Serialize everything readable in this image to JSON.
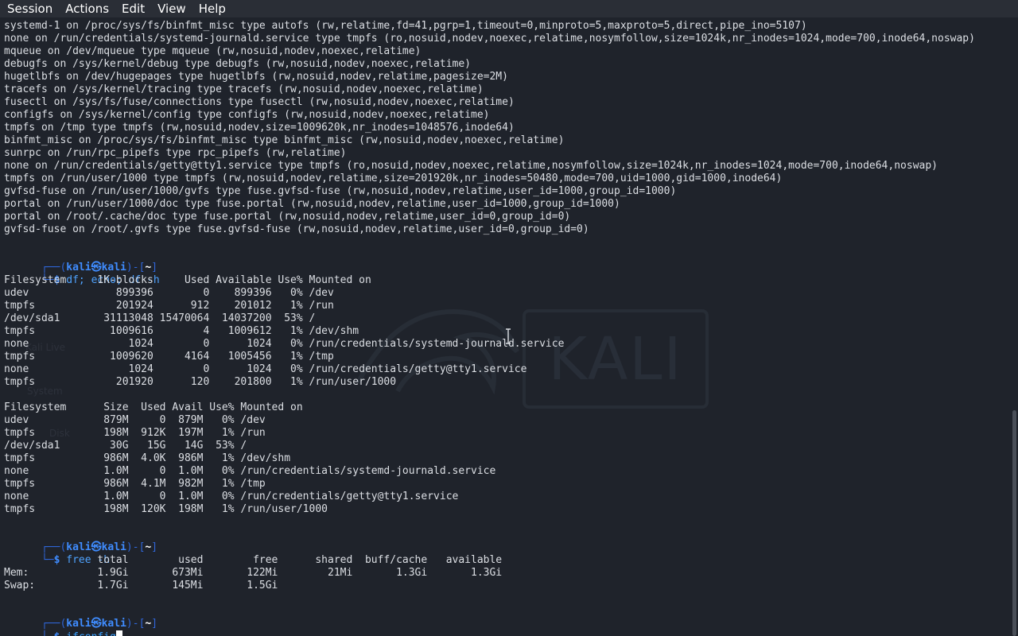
{
  "menu": [
    "Session",
    "Actions",
    "Edit",
    "View",
    "Help"
  ],
  "watermark": "KALI",
  "ghost_icons": [
    "Kali Live",
    "System",
    "Disk"
  ],
  "mount_output": [
    "systemd-1 on /proc/sys/fs/binfmt_misc type autofs (rw,relatime,fd=41,pgrp=1,timeout=0,minproto=5,maxproto=5,direct,pipe_ino=5107)",
    "none on /run/credentials/systemd-journald.service type tmpfs (ro,nosuid,nodev,noexec,relatime,nosymfollow,size=1024k,nr_inodes=1024,mode=700,inode64,noswap)",
    "mqueue on /dev/mqueue type mqueue (rw,nosuid,nodev,noexec,relatime)",
    "debugfs on /sys/kernel/debug type debugfs (rw,nosuid,nodev,noexec,relatime)",
    "hugetlbfs on /dev/hugepages type hugetlbfs (rw,nosuid,nodev,relatime,pagesize=2M)",
    "tracefs on /sys/kernel/tracing type tracefs (rw,nosuid,nodev,noexec,relatime)",
    "fusectl on /sys/fs/fuse/connections type fusectl (rw,nosuid,nodev,noexec,relatime)",
    "configfs on /sys/kernel/config type configfs (rw,nosuid,nodev,noexec,relatime)",
    "tmpfs on /tmp type tmpfs (rw,nosuid,nodev,size=1009620k,nr_inodes=1048576,inode64)",
    "binfmt_misc on /proc/sys/fs/binfmt_misc type binfmt_misc (rw,nosuid,nodev,noexec,relatime)",
    "sunrpc on /run/rpc_pipefs type rpc_pipefs (rw,relatime)",
    "none on /run/credentials/getty@tty1.service type tmpfs (ro,nosuid,nodev,noexec,relatime,nosymfollow,size=1024k,nr_inodes=1024,mode=700,inode64,noswap)",
    "tmpfs on /run/user/1000 type tmpfs (rw,nosuid,nodev,relatime,size=201920k,nr_inodes=50480,mode=700,uid=1000,gid=1000,inode64)",
    "gvfsd-fuse on /run/user/1000/gvfs type fuse.gvfsd-fuse (rw,nosuid,nodev,relatime,user_id=1000,group_id=1000)",
    "portal on /run/user/1000/doc type fuse.portal (rw,nosuid,nodev,relatime,user_id=1000,group_id=1000)",
    "portal on /root/.cache/doc type fuse.portal (rw,nosuid,nodev,relatime,user_id=0,group_id=0)",
    "gvfsd-fuse on /root/.gvfs type fuse.gvfsd-fuse (rw,nosuid,nodev,relatime,user_id=0,group_id=0)"
  ],
  "prompt": {
    "open": "┌──(",
    "user": "kali",
    "at": "㉿",
    "host": "kali",
    "mid": ")-[",
    "dir": "~",
    "close": "]",
    "second": "└─",
    "dollar": "$ "
  },
  "cmd1": "df; echo; df -h",
  "df_output": [
    "Filesystem     1K-blocks     Used Available Use% Mounted on",
    "udev              899396        0    899396   0% /dev",
    "tmpfs             201924      912    201012   1% /run",
    "/dev/sda1       31113048 15470064  14037200  53% /",
    "tmpfs            1009616        4   1009612   1% /dev/shm",
    "none                1024        0      1024   0% /run/credentials/systemd-journald.service",
    "tmpfs            1009620     4164   1005456   1% /tmp",
    "none                1024        0      1024   0% /run/credentials/getty@tty1.service",
    "tmpfs             201920      120    201800   1% /run/user/1000",
    "",
    "Filesystem      Size  Used Avail Use% Mounted on",
    "udev            879M     0  879M   0% /dev",
    "tmpfs           198M  912K  197M   1% /run",
    "/dev/sda1        30G   15G   14G  53% /",
    "tmpfs           986M  4.0K  986M   1% /dev/shm",
    "none            1.0M     0  1.0M   0% /run/credentials/systemd-journald.service",
    "tmpfs           986M  4.1M  982M   1% /tmp",
    "none            1.0M     0  1.0M   0% /run/credentials/getty@tty1.service",
    "tmpfs           198M  120K  198M   1% /run/user/1000"
  ],
  "cmd2": "free -h",
  "free_output": [
    "               total        used        free      shared  buff/cache   available",
    "Mem:           1.9Gi       673Mi       122Mi        21Mi       1.3Gi       1.3Gi",
    "Swap:          1.7Gi       145Mi       1.5Gi"
  ],
  "cmd3": "ifconfig"
}
